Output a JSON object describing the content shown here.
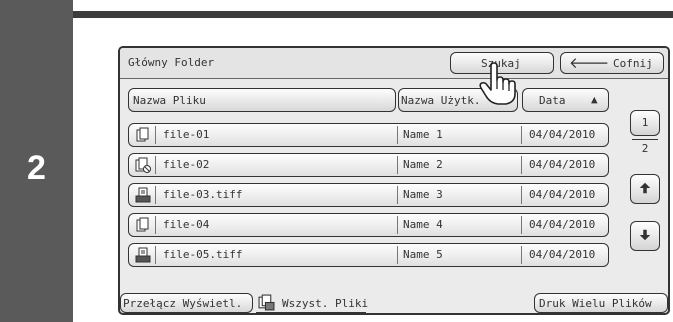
{
  "step": "2",
  "window": {
    "title": "Główny Folder"
  },
  "toolbar": {
    "search_label": "Szukaj",
    "back_label": "Cofnij"
  },
  "columns": {
    "file_name": "Nazwa Pliku",
    "user_name": "Nazwa Użytk.",
    "date": "Data",
    "date_sort_indicator": "▲"
  },
  "files": [
    {
      "name": "file-01",
      "user": "Name 1",
      "date": "04/04/2010",
      "icon": "copy-document-icon"
    },
    {
      "name": "file-02",
      "user": "Name 2",
      "date": "04/04/2010",
      "icon": "copy-document-prohibited-icon"
    },
    {
      "name": "file-03.tiff",
      "user": "Name 3",
      "date": "04/04/2010",
      "icon": "scanner-document-icon"
    },
    {
      "name": "file-04",
      "user": "Name 4",
      "date": "04/04/2010",
      "icon": "copy-document-icon"
    },
    {
      "name": "file-05.tiff",
      "user": "Name 5",
      "date": "04/04/2010",
      "icon": "scanner-document-icon"
    }
  ],
  "pagination": {
    "current_page": "1",
    "total_pages": "2"
  },
  "bottom": {
    "switch_view_label": "Przełącz Wyświetl.",
    "all_files_label": "Wszyst. Pliki",
    "batch_print_label": "Druk Wielu Plików"
  }
}
